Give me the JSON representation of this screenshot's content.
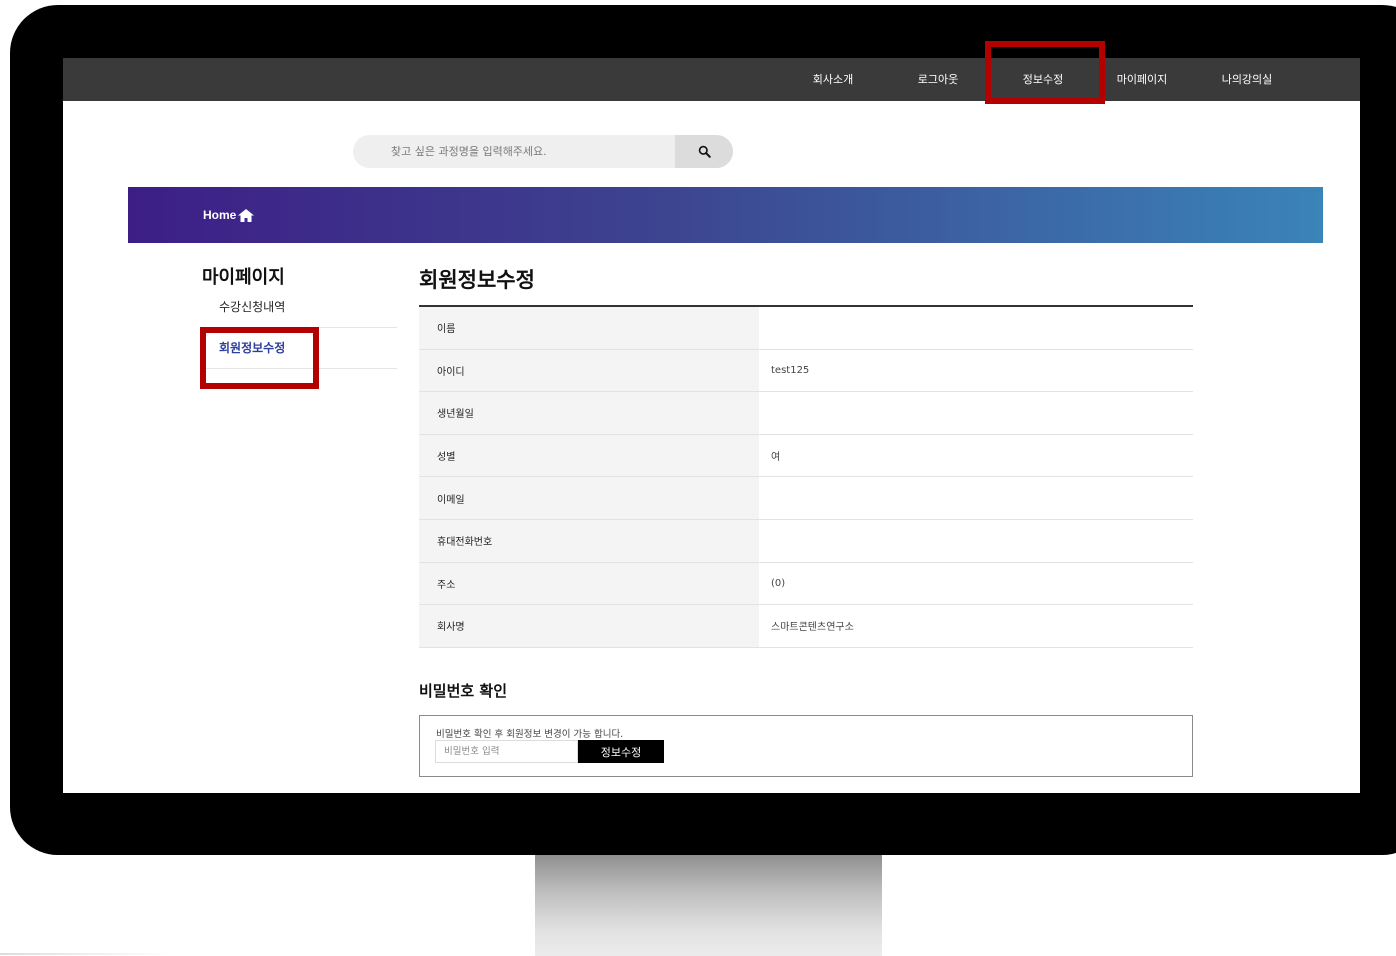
{
  "nav": {
    "items": [
      "회사소개",
      "로그아웃",
      "정보수정",
      "마이페이지",
      "나의강의실"
    ]
  },
  "search": {
    "placeholder": "찾고 싶은 과정명을 입력해주세요.",
    "button_icon": "search-icon"
  },
  "banner": {
    "home_label": "Home",
    "home_icon": "home-icon",
    "gradient_start": "#3d1e86",
    "gradient_end": "#3a84b8"
  },
  "sidebar": {
    "title": "마이페이지",
    "items": [
      {
        "label": "수강신청내역",
        "active": false
      },
      {
        "label": "회원정보수정",
        "active": true
      }
    ],
    "active_color": "#2c3e9e"
  },
  "main": {
    "title": "회원정보수정",
    "rows": [
      {
        "label": "이름",
        "value": ""
      },
      {
        "label": "아이디",
        "value": "test125"
      },
      {
        "label": "생년월일",
        "value": ""
      },
      {
        "label": "성별",
        "value": "여"
      },
      {
        "label": "이메일",
        "value": ""
      },
      {
        "label": "휴대전화번호",
        "value": ""
      },
      {
        "label": "주소",
        "value": "(0)"
      },
      {
        "label": "회사명",
        "value": "스마트콘텐츠연구소"
      }
    ]
  },
  "password_check": {
    "title": "비밀번호 확인",
    "note": "비밀번호 확인 후 회원정보 변경이 가능 합니다.",
    "input_placeholder": "비밀번호 입력",
    "button_label": "정보수정"
  },
  "colors": {
    "nav_bg": "#3a3a3a",
    "highlight": "#b30000",
    "monitor": "#000000"
  }
}
